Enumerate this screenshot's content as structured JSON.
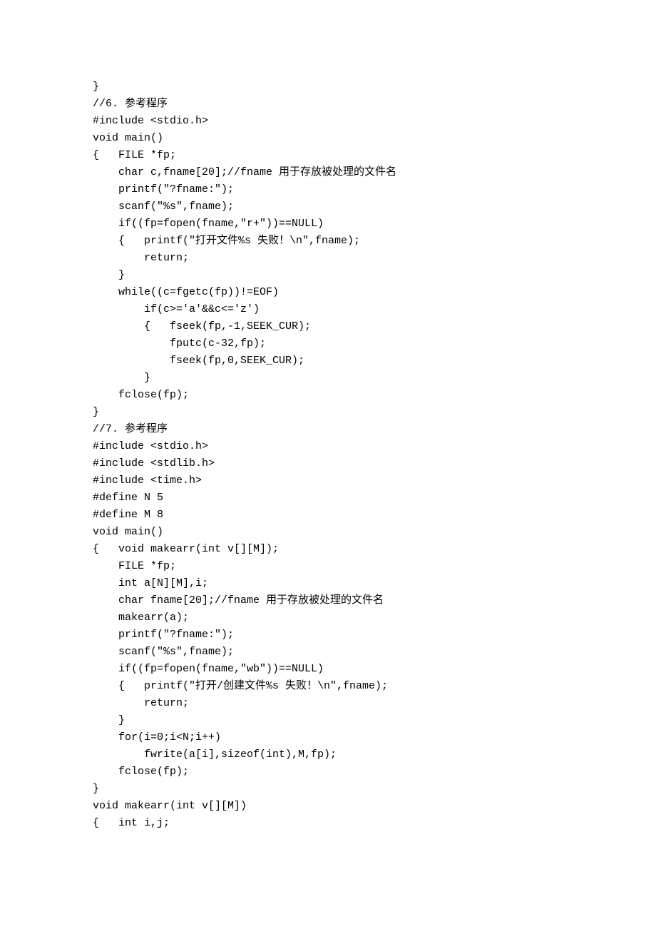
{
  "code": {
    "lines": [
      "}",
      "//6. 参考程序",
      "#include <stdio.h>",
      "void main()",
      "{   FILE *fp;",
      "    char c,fname[20];//fname 用于存放被处理的文件名",
      "    printf(\"?fname:\");",
      "    scanf(\"%s\",fname);",
      "    if((fp=fopen(fname,\"r+\"))==NULL)",
      "    {   printf(\"打开文件%s 失败！\\n\",fname);",
      "        return;",
      "    }",
      "    while((c=fgetc(fp))!=EOF)",
      "        if(c>='a'&&c<='z')",
      "        {   fseek(fp,-1,SEEK_CUR);",
      "            fputc(c-32,fp);",
      "            fseek(fp,0,SEEK_CUR);",
      "        }",
      "    fclose(fp);",
      "}",
      "//7. 参考程序",
      "#include <stdio.h>",
      "#include <stdlib.h>",
      "#include <time.h>",
      "#define N 5",
      "#define M 8",
      "void main()",
      "{   void makearr(int v[][M]);",
      "    FILE *fp;",
      "    int a[N][M],i;",
      "    char fname[20];//fname 用于存放被处理的文件名",
      "    makearr(a);",
      "    printf(\"?fname:\");",
      "    scanf(\"%s\",fname);",
      "    if((fp=fopen(fname,\"wb\"))==NULL)",
      "    {   printf(\"打开/创建文件%s 失败！\\n\",fname);",
      "        return;",
      "    }",
      "    for(i=0;i<N;i++)",
      "        fwrite(a[i],sizeof(int),M,fp);",
      "    fclose(fp);",
      "}",
      "void makearr(int v[][M])",
      "{   int i,j;"
    ]
  }
}
